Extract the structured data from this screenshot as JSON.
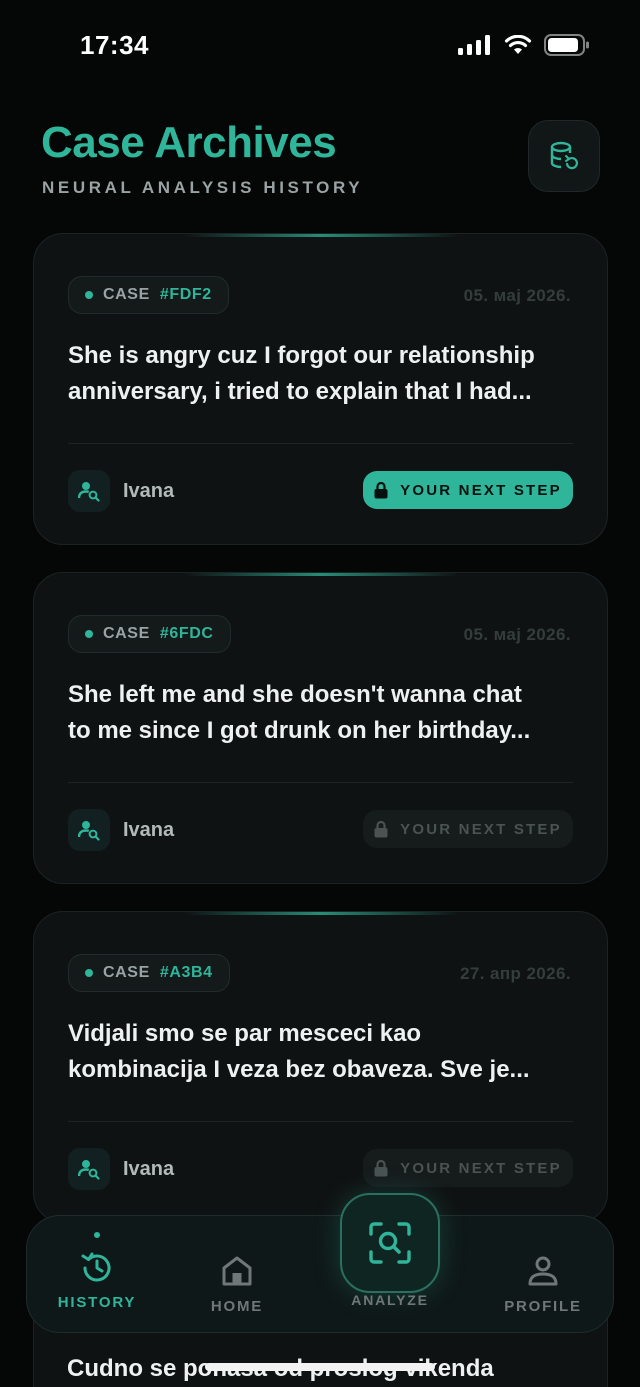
{
  "status_bar": {
    "time": "17:34"
  },
  "header": {
    "title": "Case Archives",
    "subtitle": "NEURAL ANALYSIS HISTORY"
  },
  "cases": [
    {
      "case_label": "CASE",
      "case_id": "#FDF2",
      "date": "05. мај 2026.",
      "text_lines": [
        "She is angry cuz I forgot our relationship",
        "anniversary, i tried to explain that I had..."
      ],
      "person": "Ivana",
      "next_step_label": "YOUR NEXT STEP",
      "next_step_locked": false
    },
    {
      "case_label": "CASE",
      "case_id": "#6FDC",
      "date": "05. мај 2026.",
      "text_lines": [
        "She left me and she doesn't wanna chat",
        "to me since I got drunk on her birthday..."
      ],
      "person": "Ivana",
      "next_step_label": "YOUR NEXT STEP",
      "next_step_locked": true
    },
    {
      "case_label": "CASE",
      "case_id": "#A3B4",
      "date": "27. апр 2026.",
      "text_lines": [
        "Vidjali smo se par mesceci kao",
        "kombinacija I veza bez obaveza. Sve je..."
      ],
      "person": "Ivana",
      "next_step_label": "YOUR NEXT STEP",
      "next_step_locked": true
    }
  ],
  "peek_card": {
    "text": "Cudno se ponasa od proslog vikenda"
  },
  "tabbar": {
    "history": "HISTORY",
    "home": "HOME",
    "analyze": "ANALYZE",
    "profile": "PROFILE"
  },
  "colors": {
    "accent": "#2fb59a",
    "background": "#050606",
    "card": "#0f1212",
    "locked": "#4a5252"
  }
}
